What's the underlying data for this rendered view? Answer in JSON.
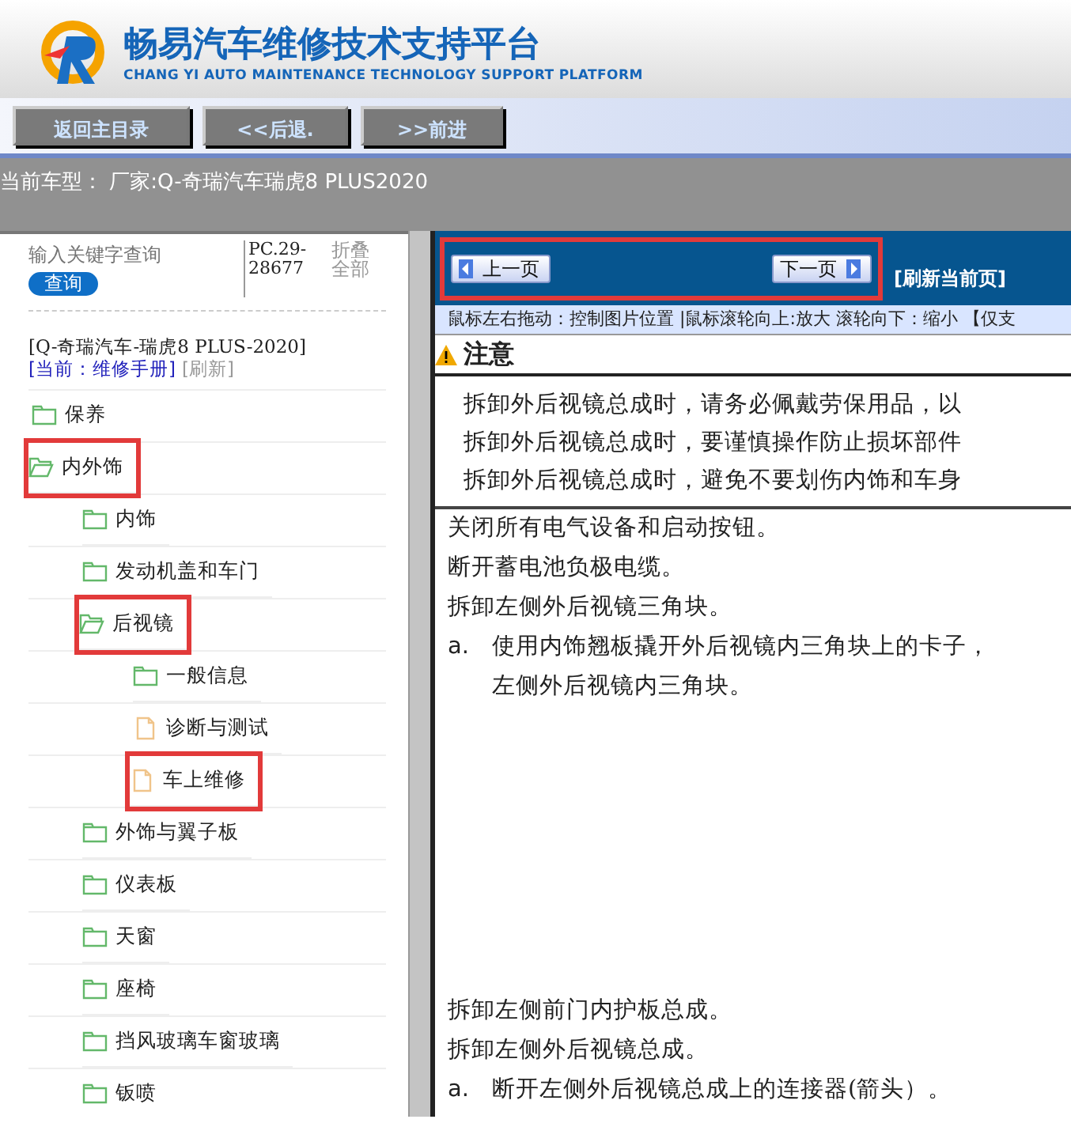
{
  "header": {
    "title": "畅易汽车维修技术支持平台",
    "subtitle": "CHANG YI AUTO MAINTENANCE TECHNOLOGY SUPPORT PLATFORM"
  },
  "toolbar": [
    "返回主目录",
    "<<后退.",
    ">>前进"
  ],
  "current_model": "当前车型： 厂家:Q-奇瑞汽车瑞虎8 PLUS2020",
  "sidebar": {
    "search": {
      "placeholder": "输入关键字查询",
      "button": "查询"
    },
    "code": "PC.29-28677",
    "collapse": "折叠全部",
    "model": "[Q-奇瑞汽车-瑞虎8 PLUS-2020]",
    "current": "[当前：维修手册]",
    "refresh": "[刷新]",
    "tree": [
      {
        "label": "保养",
        "kind": "folder",
        "expanded": false,
        "highlighted": false
      },
      {
        "label": "内外饰",
        "kind": "folder",
        "expanded": true,
        "highlighted": true,
        "children": [
          {
            "label": "内饰",
            "kind": "folder",
            "expanded": false,
            "highlighted": false
          },
          {
            "label": "发动机盖和车门",
            "kind": "folder",
            "expanded": false,
            "highlighted": false
          },
          {
            "label": "后视镜",
            "kind": "folder",
            "expanded": true,
            "highlighted": true,
            "children": [
              {
                "label": "一般信息",
                "kind": "folder",
                "expanded": false,
                "highlighted": false
              },
              {
                "label": "诊断与测试",
                "kind": "document",
                "highlighted": false
              },
              {
                "label": "车上维修",
                "kind": "document",
                "highlighted": true
              }
            ]
          },
          {
            "label": "外饰与翼子板",
            "kind": "folder",
            "expanded": false,
            "highlighted": false
          },
          {
            "label": "仪表板",
            "kind": "folder",
            "expanded": false,
            "highlighted": false
          },
          {
            "label": "天窗",
            "kind": "folder",
            "expanded": false,
            "highlighted": false
          },
          {
            "label": "座椅",
            "kind": "folder",
            "expanded": false,
            "highlighted": false
          },
          {
            "label": "挡风玻璃车窗玻璃",
            "kind": "folder",
            "expanded": false,
            "highlighted": false
          },
          {
            "label": "钣喷",
            "kind": "folder",
            "expanded": false,
            "highlighted": false
          }
        ]
      }
    ]
  },
  "viewer": {
    "prev": "上一页",
    "next": "下一页",
    "pager_highlighted": true,
    "refresh": "[刷新当前页]",
    "hint": "鼠标左右拖动：控制图片位置 |鼠标滚轮向上:放大  滚轮向下：缩小 【仅支",
    "notice": {
      "title": "注意",
      "lines": [
        "拆卸外后视镜总成时，请务必佩戴劳保用品，以",
        "拆卸外后视镜总成时，要谨慎操作防止损坏部件",
        "拆卸外后视镜总成时，避免不要划伤内饰和车身"
      ]
    },
    "steps": [
      {
        "kind": "step",
        "text": "关闭所有电气设备和启动按钮。"
      },
      {
        "kind": "step",
        "text": "断开蓄电池负极电缆。"
      },
      {
        "kind": "step",
        "text": "拆卸左侧外后视镜三角块。"
      },
      {
        "kind": "substep",
        "marker": "a.",
        "text": "使用内饰翘板撬开外后视镜内三角块上的卡子，",
        "text2": "左侧外后视镜内三角块。"
      },
      {
        "kind": "gap"
      },
      {
        "kind": "step",
        "text": "拆卸左侧前门内护板总成。"
      },
      {
        "kind": "step",
        "text": "拆卸左侧外后视镜总成。"
      },
      {
        "kind": "substep",
        "marker": "a.",
        "text": "断开左侧外后视镜总成上的连接器(箭头）。"
      }
    ]
  }
}
